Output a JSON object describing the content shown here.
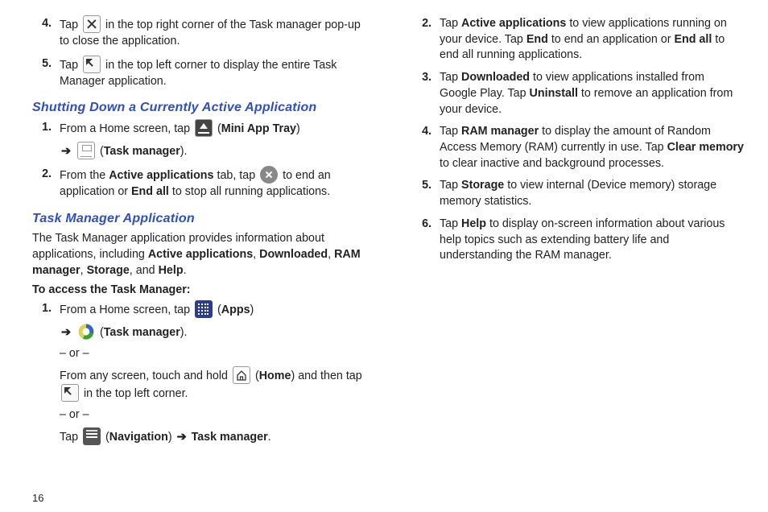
{
  "pageNumber": "16",
  "left": {
    "top": {
      "s4": {
        "pre": "Tap ",
        "post": " in the top right corner of the Task manager pop-up to close the application."
      },
      "s5": {
        "pre": "Tap ",
        "post": " in the top left corner to display the entire Task Manager application."
      }
    },
    "shutHead": "Shutting Down a Currently Active Application",
    "shut": {
      "s1": {
        "pre": "From a Home screen, tap ",
        "miniLabel": "Mini App Tray",
        "tmLabel": "Task manager"
      },
      "s2": {
        "pre": "From the ",
        "activeTab": "Active applications",
        "mid": " tab, tap ",
        "post": " to end an application or ",
        "endAll": "End all",
        "tail": " to stop all running applications."
      }
    },
    "tmHead": "Task Manager Application",
    "tmIntro": {
      "a": "The Task Manager application provides information about applications, including ",
      "k1": "Active applications",
      "k2": "Downloaded",
      "k3": "RAM manager",
      "k4": "Storage",
      "k5": "Help"
    },
    "accessLead": "To access the Task Manager:",
    "access": {
      "s1": {
        "pre": "From a Home screen, tap ",
        "appsLabel": "Apps",
        "tmLabel": "Task manager",
        "or": "– or –",
        "line2a": "From any screen, touch and hold ",
        "homeLabel": "Home",
        "line2b": " and then tap ",
        "line2c": " in the top left corner.",
        "line3a": "Tap ",
        "navLabel": "Navigation",
        "line3b": "Task manager"
      }
    }
  },
  "right": {
    "s2": {
      "pre": "Tap ",
      "k": "Active applications",
      "mid": " to view applications running on your device. Tap ",
      "k2": "End",
      "mid2": " to end an application or ",
      "k3": "End all",
      "tail": " to end all running applications."
    },
    "s3": {
      "pre": "Tap ",
      "k": "Downloaded",
      "mid": " to view applications installed from Google Play. Tap ",
      "k2": "Uninstall",
      "tail": " to remove an application from your device."
    },
    "s4": {
      "pre": "Tap ",
      "k": "RAM manager",
      "mid": " to display the amount of Random Access Memory (RAM) currently in use. Tap ",
      "k2": "Clear memory",
      "tail": " to clear inactive and background processes."
    },
    "s5": {
      "pre": "Tap ",
      "k": "Storage",
      "tail": " to view internal (Device memory) storage memory statistics."
    },
    "s6": {
      "pre": "Tap ",
      "k": "Help",
      "tail": " to display on-screen information about various help topics such as extending battery life and understanding the RAM manager."
    }
  }
}
